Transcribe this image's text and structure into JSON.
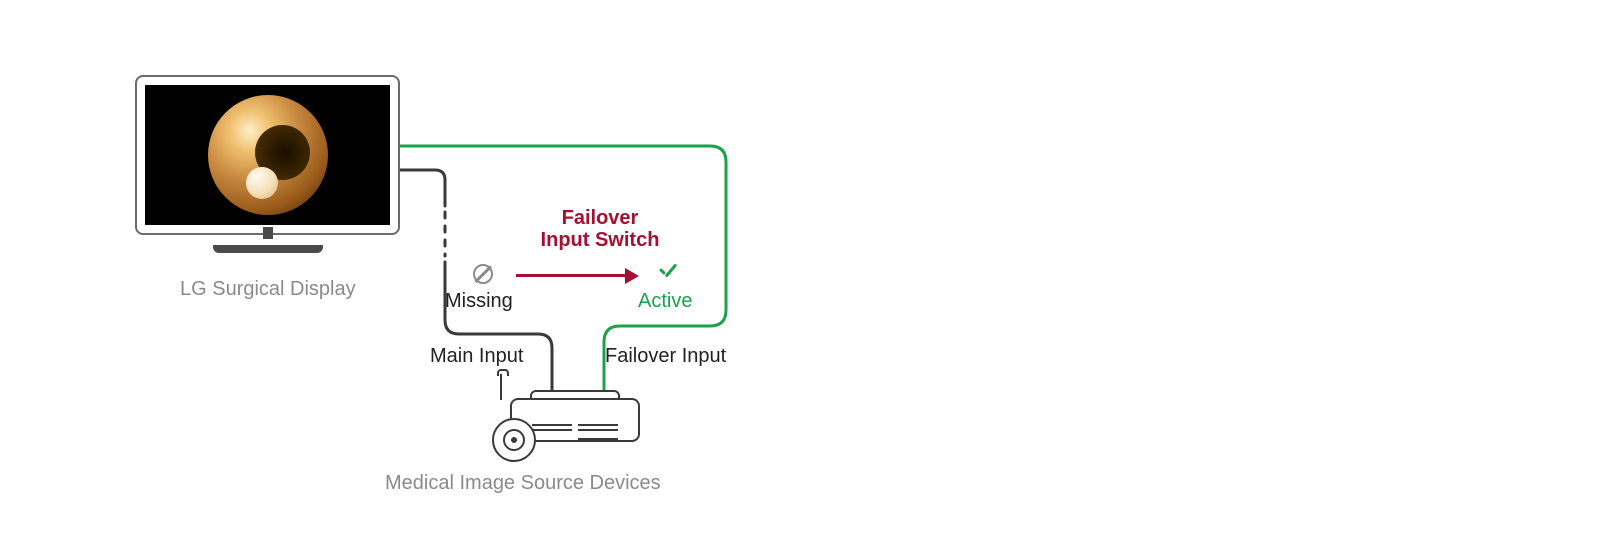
{
  "captions": {
    "display": "LG Surgical Display",
    "devices": "Medical Image Source Devices"
  },
  "switch": {
    "title_line1": "Failover",
    "title_line2": "Input Switch",
    "missing_label": "Missing",
    "active_label": "Active"
  },
  "inputs": {
    "main_label": "Main Input",
    "failover_label": "Failover Input"
  },
  "colors": {
    "accent_red": "#a31031",
    "accent_green": "#19a24a",
    "wire_dark": "#3a3a3a",
    "caption_grey": "#8a8a8a"
  }
}
